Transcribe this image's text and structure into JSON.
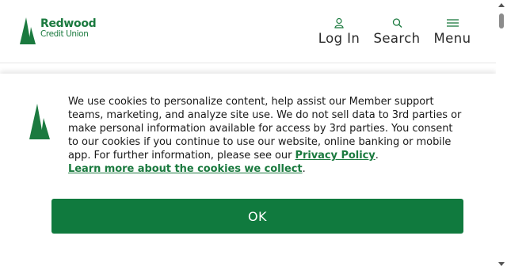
{
  "brand": {
    "name_line1": "Redwood",
    "name_line2": "Credit Union",
    "color": "#1b7a3f"
  },
  "nav": {
    "login": {
      "label": "Log In",
      "icon": "user-icon"
    },
    "search": {
      "label": "Search",
      "icon": "search-icon"
    },
    "menu": {
      "label": "Menu",
      "icon": "hamburger-icon"
    }
  },
  "cookie_banner": {
    "message": "We use cookies to personalize content, help assist our Member support teams, marketing, and analyze site use. We do not sell data to 3rd parties or make personal information available for access by 3rd parties. You consent to our cookies if you continue to use our website, online banking or mobile app. For further information, please see our ",
    "privacy_link": "Privacy Policy",
    "after_link": ".",
    "learn_more_link": "Learn more about the cookies we collect",
    "learn_more_after": ".",
    "ok_label": "OK",
    "button_color": "#107a3e"
  }
}
